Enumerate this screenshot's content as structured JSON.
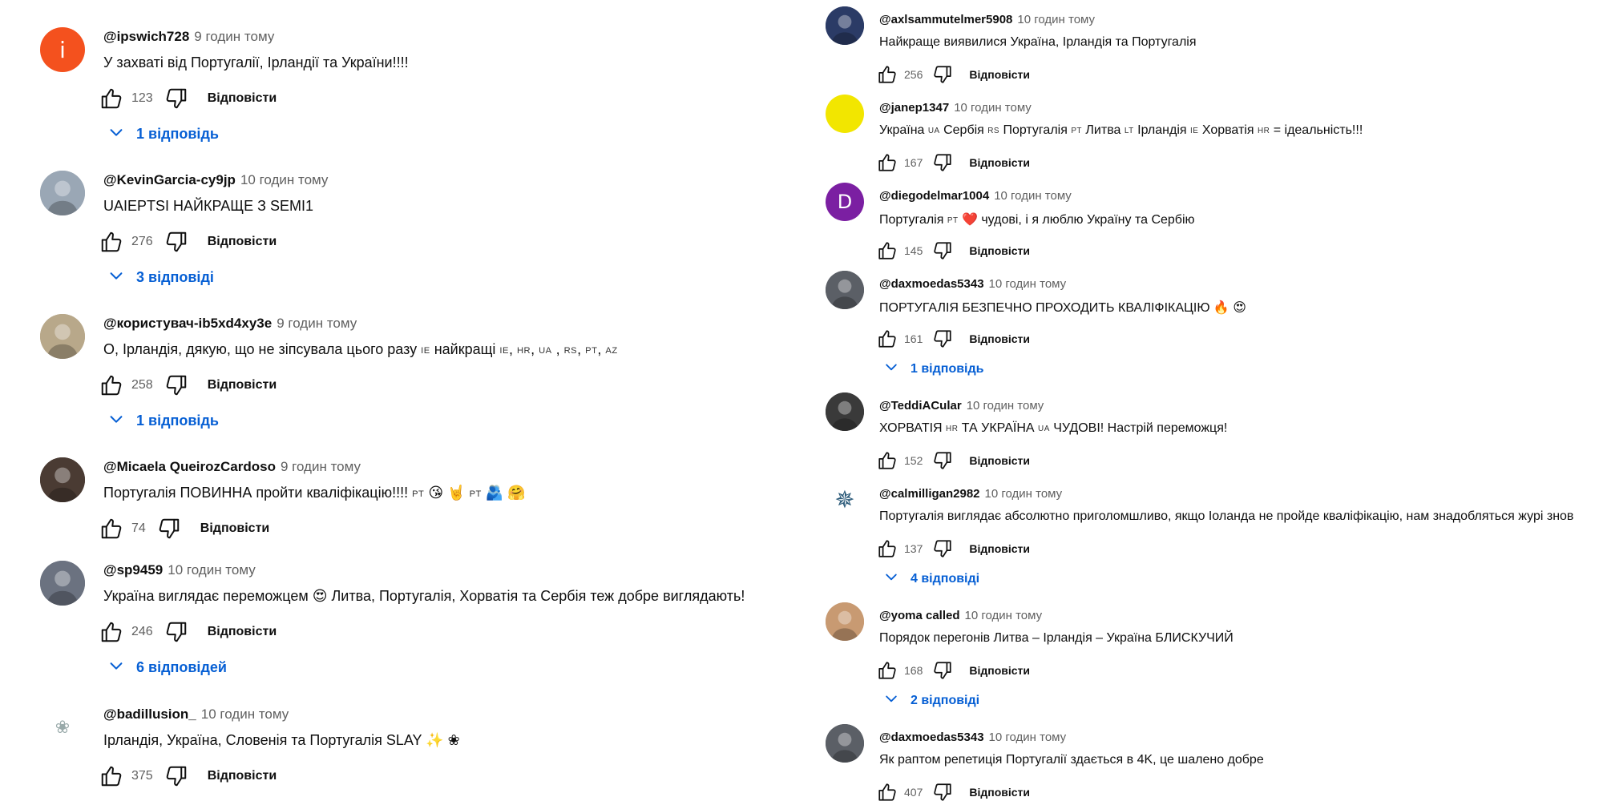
{
  "ui": {
    "reply_label": "Відповісти"
  },
  "left": [
    {
      "author": "@ipswich728",
      "time": "9 годин тому",
      "text": "У захваті від Португалії, Ірландії та України!!!!",
      "likes": "123",
      "replies": "1 відповідь",
      "avatar": {
        "type": "letter",
        "letter": "і",
        "color": "#f4511e"
      }
    },
    {
      "author": "@KevinGarcia-cy9jp",
      "time": "10 годин тому",
      "text": "UAIEPTSI НАЙКРАЩЕ З SEMI1",
      "likes": "276",
      "replies": "3 відповіді",
      "avatar": {
        "type": "photo",
        "color": "#9aa7b5"
      }
    },
    {
      "author": "@користувач-ib5xd4xy3e",
      "time": "9 годин тому",
      "text": "О, Ірландія, дякую, що не зіпсувала цього разу IE найкращі IE, HR, UA , RS, PT, AZ",
      "likes": "258",
      "replies": "1 відповідь",
      "avatar": {
        "type": "photo",
        "color": "#b8a88a"
      }
    },
    {
      "author": "@Micaela QueirozCardoso",
      "time": "9 годин тому",
      "text": "Португалія ПОВИННА пройти кваліфікацію!!!! PT 😘 🤘 PT 🫂 🤗",
      "likes": "74",
      "replies": "",
      "avatar": {
        "type": "photo",
        "color": "#4a3b33"
      }
    },
    {
      "author": "@sp9459",
      "time": "10 годин тому",
      "text": "Україна виглядає переможцем 😍 Литва, Португалія, Хорватія та Сербія теж добре виглядають!",
      "likes": "246",
      "replies": "6 відповідей",
      "avatar": {
        "type": "photo",
        "color": "#6b7280"
      }
    },
    {
      "author": "@badillusion_",
      "time": "10 годин тому",
      "text": "Ірландія, Україна, Словенія та Португалія SLAY ✨ ❀",
      "likes": "375",
      "replies": "",
      "avatar": {
        "type": "flower",
        "color": "#ffffff"
      }
    }
  ],
  "right": [
    {
      "author": "@axlsammutelmer5908",
      "time": "10 годин тому",
      "text": "Найкраще виявилися Україна, Ірландія та Португалія",
      "likes": "256",
      "replies": "",
      "avatar": {
        "type": "photo",
        "color": "#2b3b66"
      }
    },
    {
      "author": "@janep1347",
      "time": "10 годин тому",
      "text": "Україна UA Сербія RS Португалія PT Литва LT Ірландія IE Хорватія HR = ідеальність!!!",
      "likes": "167",
      "replies": "",
      "avatar": {
        "type": "solid",
        "color": "#f2e600"
      }
    },
    {
      "author": "@diegodelmar1004",
      "time": "10 годин тому",
      "text": "Португалія PT ❤️ чудові, і я люблю Україну та Сербію",
      "likes": "145",
      "replies": "",
      "avatar": {
        "type": "letter",
        "letter": "D",
        "color": "#7b1fa2"
      }
    },
    {
      "author": "@daxmoedas5343",
      "time": "10 годин тому",
      "text": "ПОРТУГАЛІЯ БЕЗПЕЧНО ПРОХОДИТЬ КВАЛІФІКАЦІЮ 🔥 😍",
      "likes": "161",
      "replies": "1 відповідь",
      "avatar": {
        "type": "photo",
        "color": "#5b5f66"
      }
    },
    {
      "author": "@TeddiACular",
      "time": "10 годин тому",
      "text": "ХОРВАТІЯ HR ТА УКРАЇНА UA ЧУДОВІ! Настрій переможця!",
      "likes": "152",
      "replies": "",
      "avatar": {
        "type": "photo",
        "color": "#3a3a3a"
      }
    },
    {
      "author": "@calmilligan2982",
      "time": "10 годин тому",
      "text": "Португалія виглядає абсолютно приголомшливо, якщо Іоланда не пройде кваліфікацію, нам знадобляться журі знов",
      "likes": "137",
      "replies": "4 відповіді",
      "avatar": {
        "type": "star",
        "color": "#ffffff"
      }
    },
    {
      "author": "@yoma called",
      "time": "10 годин тому",
      "text": "Порядок перегонів Литва – Ірландія – Україна БЛИСКУЧИЙ",
      "likes": "168",
      "replies": "2 відповіді",
      "avatar": {
        "type": "photo",
        "color": "#c89a72"
      }
    },
    {
      "author": "@daxmoedas5343",
      "time": "10 годин тому",
      "text": "Як раптом репетиція Португалії здається в 4K, це шалено добре",
      "likes": "407",
      "replies": "",
      "avatar": {
        "type": "photo",
        "color": "#5b5f66"
      }
    }
  ]
}
